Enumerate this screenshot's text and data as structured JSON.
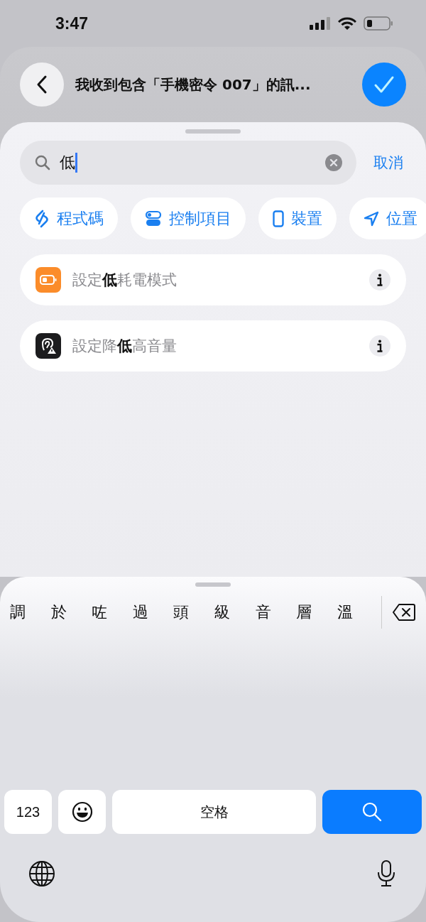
{
  "status_bar": {
    "time": "3:47"
  },
  "header": {
    "title": "我收到包含「手機密令 007」的訊..."
  },
  "search": {
    "value": "低",
    "cancel": "取消"
  },
  "categories": [
    {
      "label": "程式碼",
      "kind": "code"
    },
    {
      "label": "控制項目",
      "kind": "toggle"
    },
    {
      "label": "裝置",
      "kind": "phone"
    },
    {
      "label": "位置",
      "kind": "location"
    }
  ],
  "results": [
    {
      "title": "設定**低**耗電模式",
      "kind": "battery"
    },
    {
      "title": "設定降**低**高音量",
      "kind": "ear"
    }
  ],
  "keyboard": {
    "candidates": [
      "調",
      "於",
      "咗",
      "過",
      "頭",
      "級",
      "音",
      "層",
      "溫"
    ],
    "numbers_key": "123",
    "space_key": "空格"
  }
}
